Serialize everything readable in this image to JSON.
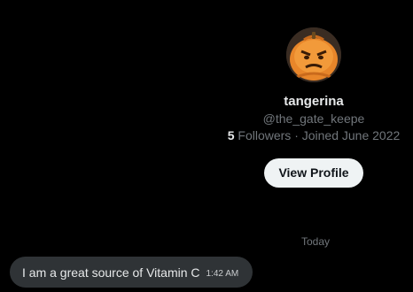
{
  "profile": {
    "avatar_icon": "pumpkin-face-avatar",
    "display_name": "tangerina",
    "handle": "@the_gate_keepe",
    "followers_count": "5",
    "followers_label": "Followers",
    "separator": "·",
    "joined": "Joined June 2022",
    "view_profile_label": "View Profile"
  },
  "conversation": {
    "day_separator": "Today",
    "messages": [
      {
        "text": "I am a great source of Vitamin C",
        "time": "1:42 AM"
      }
    ]
  },
  "colors": {
    "background": "#000000",
    "primary_text": "#e7e9ea",
    "secondary_text": "#71767b",
    "button_bg": "#eff3f4",
    "bubble_bg": "#2f3336",
    "avatar_orange": "#e8862a"
  }
}
